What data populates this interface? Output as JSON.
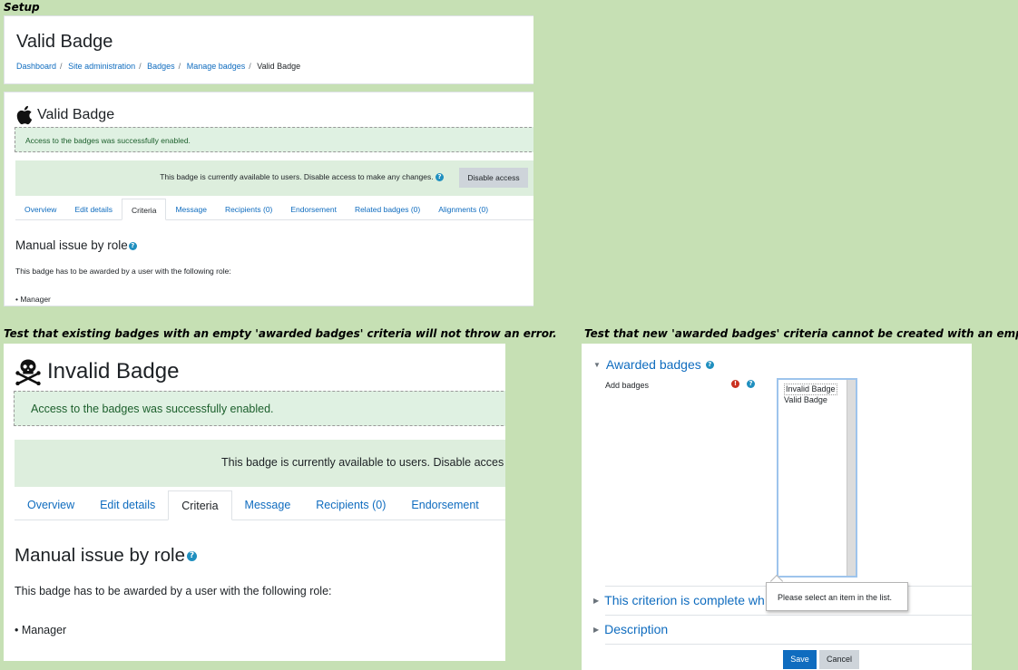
{
  "captions": {
    "setup": "Setup",
    "test_existing": "Test that existing badges with an empty 'awarded badges' criteria will not throw an error.",
    "test_new": "Test that new 'awarded badges' criteria cannot be created with an empty list."
  },
  "setup": {
    "page_title": "Valid Badge",
    "breadcrumbs": [
      "Dashboard",
      "Site administration",
      "Badges",
      "Manage badges",
      "Valid Badge"
    ],
    "badge_name": "Valid Badge",
    "badge_icon": "apple-icon",
    "alert": "Access to the badges was successfully enabled.",
    "availability": "This badge is currently available to users. Disable access to make any changes.",
    "disable_button": "Disable access",
    "tabs": [
      "Overview",
      "Edit details",
      "Criteria",
      "Message",
      "Recipients (0)",
      "Endorsement",
      "Related badges (0)",
      "Alignments (0)"
    ],
    "active_tab": "Criteria",
    "criteria_heading": "Manual issue by role",
    "criteria_desc": "This badge has to be awarded by a user with the following role:",
    "roles": [
      "Manager"
    ]
  },
  "existing": {
    "badge_name": "Invalid Badge",
    "badge_icon": "skull-crossbones-icon",
    "alert": "Access to the badges was successfully enabled.",
    "availability": "This badge is currently available to users. Disable acces",
    "tabs": [
      "Overview",
      "Edit details",
      "Criteria",
      "Message",
      "Recipients (0)",
      "Endorsement"
    ],
    "active_tab": "Criteria",
    "criteria_heading": "Manual issue by role",
    "criteria_desc": "This badge has to be awarded by a user with the following role:",
    "roles": [
      "Manager"
    ]
  },
  "new_criteria": {
    "section_awarded": "Awarded badges",
    "add_badges_label": "Add badges",
    "options": [
      "Invalid Badge",
      "Valid Badge"
    ],
    "section_complete": "This criterion is complete wh",
    "section_description": "Description",
    "tooltip": "Please select an item in the list.",
    "save": "Save",
    "cancel": "Cancel"
  },
  "colors": {
    "background": "#c6e0b4",
    "link": "#0f6cbf",
    "alert_bg": "#dff1e2",
    "availability_bg": "#ddeedd",
    "primary_button": "#0f6cbf",
    "secondary_button": "#ced4da",
    "error_icon": "#ca3120"
  }
}
